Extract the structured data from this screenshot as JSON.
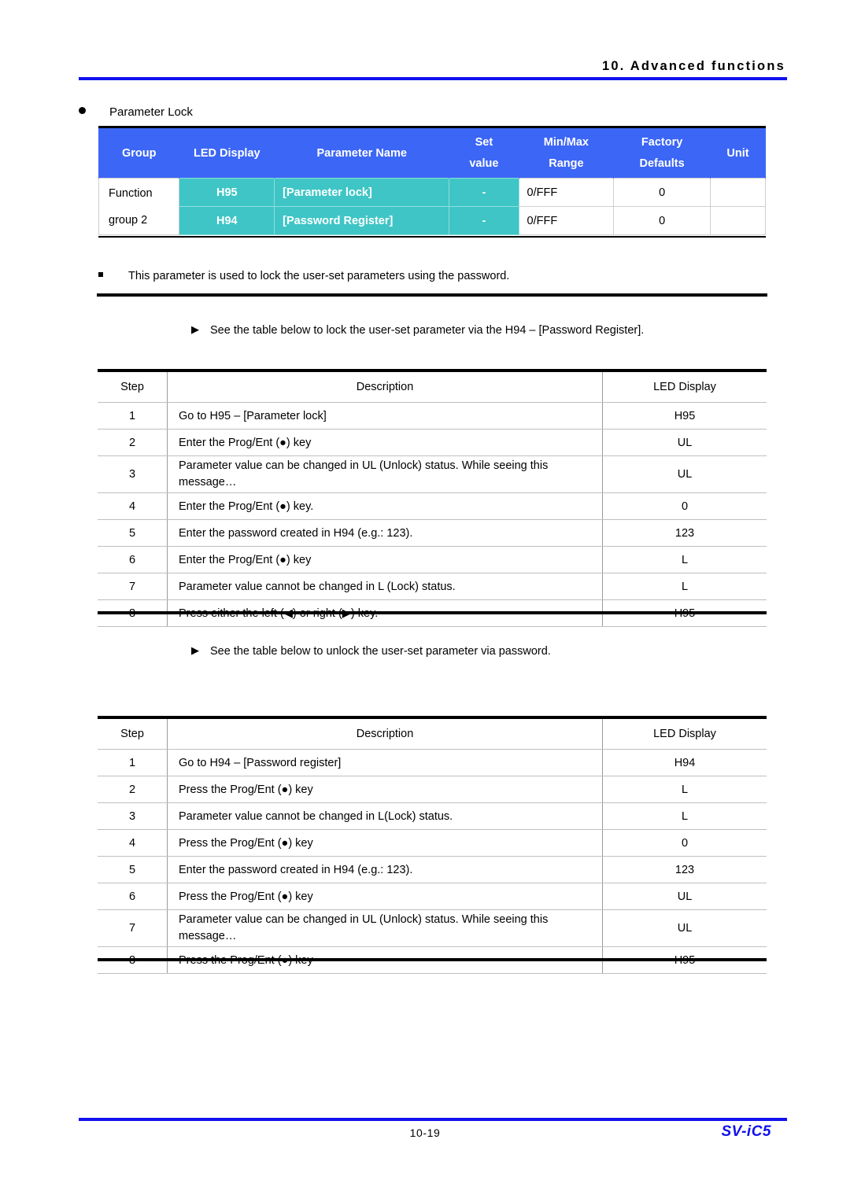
{
  "header": {
    "title": "10. Advanced functions",
    "rule_color": "#1111ee"
  },
  "section": {
    "bullet_label": "Parameter Lock"
  },
  "parameter_table": {
    "accent_header_color": "#3c66f5",
    "accent_row_color": "#3fc5c5",
    "columns": [
      {
        "label": "Group"
      },
      {
        "label": "LED Display"
      },
      {
        "label": "Parameter Name"
      },
      {
        "line1": "Set",
        "line2": "value"
      },
      {
        "line1": "Min/Max",
        "line2": "Range"
      },
      {
        "line1": "Factory",
        "line2": "Defaults"
      },
      {
        "label": "Unit"
      }
    ],
    "group_label_line1": "Function",
    "group_label_line2": "group 2",
    "rows": [
      {
        "led_display": "H95",
        "parameter_name": "[Parameter lock]",
        "set_value": "-",
        "min_max_range": "0/FFF",
        "factory_default": "0",
        "unit": ""
      },
      {
        "led_display": "H94",
        "parameter_name": "[Password Register]",
        "set_value": "-",
        "min_max_range": "0/FFF",
        "factory_default": "0",
        "unit": ""
      }
    ]
  },
  "note": {
    "text": "This parameter is used to lock the user-set parameters using the password."
  },
  "lock_section": {
    "intro": "See the table below to lock the user-set parameter via the H94 – [Password Register].",
    "headers": {
      "step": "Step",
      "description": "Description",
      "led_display": "LED Display"
    },
    "rows": [
      {
        "step": "1",
        "description": "Go to H95 – [Parameter lock]",
        "led": "H95"
      },
      {
        "step": "2",
        "description": "Enter the Prog/Ent (●) key",
        "led": "UL"
      },
      {
        "step": "3",
        "description": "Parameter value can be changed in UL (Unlock) status. While seeing this message…",
        "led": "UL"
      },
      {
        "step": "4",
        "description": "Enter the Prog/Ent (●) key.",
        "led": "0"
      },
      {
        "step": "5",
        "description": "Enter the password created in H94 (e.g.: 123).",
        "led": "123"
      },
      {
        "step": "6",
        "description": "Enter the Prog/Ent (●) key",
        "led": "L"
      },
      {
        "step": "7",
        "description": "Parameter value cannot be changed in L (Lock) status.",
        "led": "L"
      },
      {
        "step": "8",
        "description": "Press either the left (◀) or right (▶) key.",
        "led": "H95"
      }
    ]
  },
  "unlock_section": {
    "intro": "See the table below to unlock the user-set parameter via password.",
    "headers": {
      "step": "Step",
      "description": "Description",
      "led_display": "LED Display"
    },
    "rows": [
      {
        "step": "1",
        "description": "Go to H94 – [Password register]",
        "led": "H94"
      },
      {
        "step": "2",
        "description": "Press the Prog/Ent (●) key",
        "led": "L"
      },
      {
        "step": "3",
        "description": "Parameter value cannot be changed in L(Lock) status.",
        "led": "L"
      },
      {
        "step": "4",
        "description": "Press the Prog/Ent (●) key",
        "led": "0"
      },
      {
        "step": "5",
        "description": "Enter the password created in H94 (e.g.: 123).",
        "led": "123"
      },
      {
        "step": "6",
        "description": "Press the Prog/Ent (●) key",
        "led": "UL"
      },
      {
        "step": "7",
        "description": "Parameter value can be changed in UL (Unlock) status. While seeing this message…",
        "led": "UL"
      },
      {
        "step": "8",
        "description": "Press the Prog/Ent (●) key",
        "led": "H95"
      }
    ]
  },
  "footer": {
    "page_number": "10-19",
    "brand": "SV-iC5",
    "brand_color": "#1111ee"
  },
  "icons": {
    "bullet": "filled-circle-bullet",
    "note_marker": "filled-square-bullet",
    "arrow_marker": "right-triangle-arrow"
  }
}
